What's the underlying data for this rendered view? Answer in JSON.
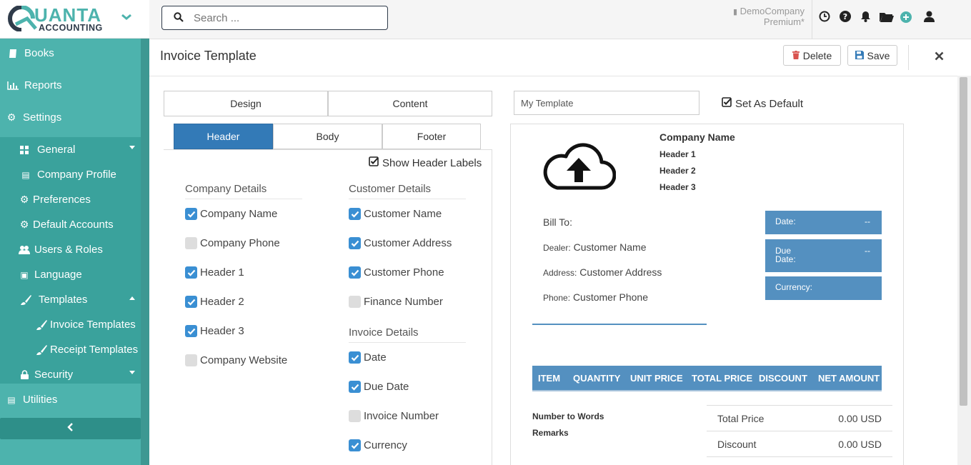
{
  "brand": {
    "name": "UANTA",
    "sub": "ACCOUNTING"
  },
  "search": {
    "placeholder": "Search ..."
  },
  "account": {
    "company": "DemoCompany",
    "plan": "Premium*"
  },
  "nav": {
    "books": "Books",
    "reports": "Reports",
    "settings": "Settings",
    "general": "General",
    "company_profile": "Company Profile",
    "preferences": "Preferences",
    "default_accounts": "Default Accounts",
    "users_roles": "Users & Roles",
    "language": "Language",
    "templates": "Templates",
    "invoice_templates": "Invoice Templates",
    "receipt_templates": "Receipt Templates",
    "security": "Security",
    "utilities": "Utilities"
  },
  "page": {
    "title": "Invoice Template",
    "delete": "Delete",
    "save": "Save"
  },
  "tabs": {
    "design": "Design",
    "content": "Content",
    "header": "Header",
    "body": "Body",
    "footer": "Footer"
  },
  "template": {
    "name": "My Template",
    "set_default": "Set As Default",
    "show_header_labels": "Show Header Labels"
  },
  "company_details": {
    "title": "Company Details",
    "items": [
      {
        "label": "Company Name",
        "checked": true
      },
      {
        "label": "Company Phone",
        "checked": false
      },
      {
        "label": "Header 1",
        "checked": true
      },
      {
        "label": "Header 2",
        "checked": true
      },
      {
        "label": "Header 3",
        "checked": true
      },
      {
        "label": "Company Website",
        "checked": false
      }
    ]
  },
  "customer_details": {
    "title": "Customer Details",
    "items": [
      {
        "label": "Customer Name",
        "checked": true
      },
      {
        "label": "Customer Address",
        "checked": true
      },
      {
        "label": "Customer Phone",
        "checked": true
      },
      {
        "label": "Finance Number",
        "checked": false
      }
    ]
  },
  "invoice_details": {
    "title": "Invoice Details",
    "items": [
      {
        "label": "Date",
        "checked": true
      },
      {
        "label": "Due Date",
        "checked": true
      },
      {
        "label": "Invoice Number",
        "checked": false
      },
      {
        "label": "Currency",
        "checked": true
      }
    ]
  },
  "preview": {
    "company_name": "Company Name",
    "header1": "Header 1",
    "header2": "Header 2",
    "header3": "Header 3",
    "bill_to": "Bill To:",
    "dealer_label": "Dealer:",
    "dealer_value": "Customer Name",
    "address_label": "Address:",
    "address_value": "Customer Address",
    "phone_label": "Phone:",
    "phone_value": "Customer Phone",
    "date_label": "Date:",
    "date_value": "--",
    "due_label_1": "Due",
    "due_label_2": "Date:",
    "due_value": "--",
    "currency_label": "Currency:",
    "columns": [
      "ITEM",
      "QUANTITY",
      "UNIT PRICE",
      "TOTAL PRICE",
      "DISCOUNT",
      "NET AMOUNT"
    ],
    "number_to_words": "Number to Words",
    "remarks": "Remarks",
    "totals": [
      {
        "label": "Total Price",
        "value": "0.00 USD"
      },
      {
        "label": "Discount",
        "value": "0.00 USD"
      }
    ]
  },
  "colors": {
    "sidebar": "#4db3ad",
    "sidebar_sub": "#3aa29c",
    "accent": "#337ab7",
    "preview_blue": "#5490c0"
  }
}
